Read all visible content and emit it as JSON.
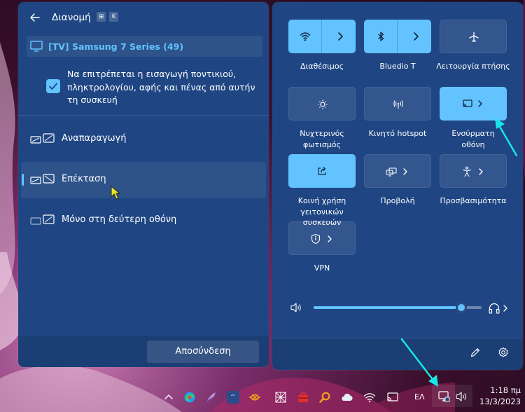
{
  "colors": {
    "accent": "#62c3ff",
    "panel": "#1f4683",
    "annotation": "#18e6e6"
  },
  "cast": {
    "title": "Διανομή",
    "shortcut_keys": [
      "⊞",
      "K"
    ],
    "device": "[TV] Samsung 7 Series (49)",
    "allow_input_checked": true,
    "allow_input_text": "Να επιτρέπεται η εισαγωγή ποντικιού, πληκτρολογίου, αφής και πένας από αυτήν τη συσκευή",
    "modes": [
      {
        "label": "Αναπαραγωγή",
        "selected": false
      },
      {
        "label": "Επέκταση",
        "selected": true
      },
      {
        "label": "Μόνο στη δεύτερη οθόνη",
        "selected": false
      }
    ],
    "disconnect_label": "Αποσύνδεση"
  },
  "quick_settings": {
    "tiles": [
      {
        "label": "Διαθέσιμος",
        "icon": "wifi-icon",
        "on": true,
        "chevron": true
      },
      {
        "label": "Bluedio T",
        "icon": "bluetooth-icon",
        "on": true,
        "chevron": true
      },
      {
        "label": "Λειτουργία πτήσης",
        "icon": "airplane-icon",
        "on": false,
        "chevron": false
      },
      {
        "label": "Νυχτερινός φωτισμός",
        "icon": "night-light-icon",
        "on": false,
        "chevron": false
      },
      {
        "label": "Κινητό hotspot",
        "icon": "hotspot-icon",
        "on": false,
        "chevron": false
      },
      {
        "label": "Ενσύρματη οθόνη",
        "icon": "cast-icon",
        "on": true,
        "chevron": true
      },
      {
        "label": "Κοινή χρήση γειτονικών συσκευών",
        "icon": "nearby-share-icon",
        "on": true,
        "chevron": false
      },
      {
        "label": "Προβολή",
        "icon": "project-icon",
        "on": false,
        "chevron": true
      },
      {
        "label": "Προσβασιμότητα",
        "icon": "accessibility-icon",
        "on": false,
        "chevron": true
      },
      {
        "label": "VPN",
        "icon": "vpn-shield-icon",
        "on": false,
        "chevron": true
      }
    ],
    "volume_percent": 88
  },
  "taskbar": {
    "language": "ΕΛ",
    "time": "1:18 πμ",
    "date": "13/3/2023",
    "icons": [
      "chevron-up-icon",
      "edge-icon",
      "feather-icon",
      "app-icon",
      "bluestacks-icon",
      "grid-icon",
      "toolbox-icon",
      "search-icon",
      "cloud-icon",
      "wifi-icon",
      "cast-icon"
    ]
  }
}
